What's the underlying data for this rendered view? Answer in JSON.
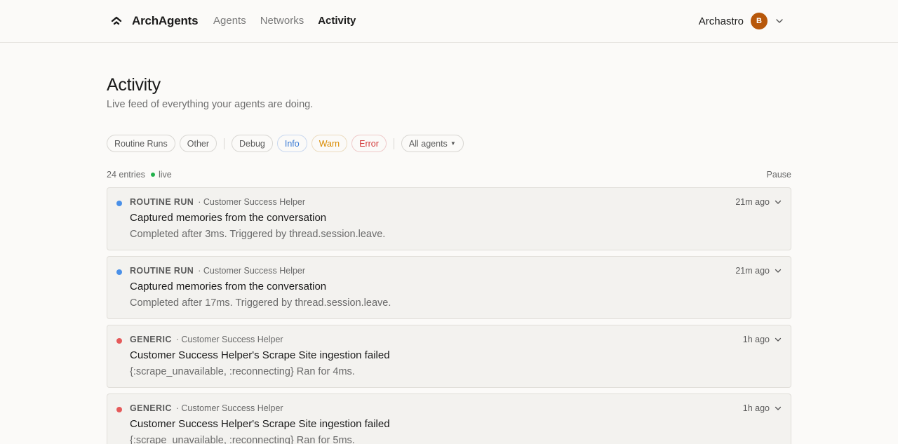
{
  "header": {
    "brand": "ArchAgents",
    "nav": [
      {
        "label": "Agents",
        "active": false
      },
      {
        "label": "Networks",
        "active": false
      },
      {
        "label": "Activity",
        "active": true
      }
    ],
    "user_name": "Archastro",
    "avatar_initial": "B",
    "avatar_color": "#b7570a"
  },
  "page": {
    "title": "Activity",
    "subtitle": "Live feed of everything your agents are doing."
  },
  "filters": {
    "routine_runs": "Routine Runs",
    "other": "Other",
    "debug": "Debug",
    "info": "Info",
    "warn": "Warn",
    "error": "Error",
    "agents_select": "All agents"
  },
  "feed_meta": {
    "entries": "24 entries",
    "live": "live",
    "pause": "Pause"
  },
  "entries": [
    {
      "kind": "ROUTINE RUN",
      "source": "· Customer Success Helper",
      "time": "21m ago",
      "title": "Captured memories from the conversation",
      "detail": "Completed after 3ms. Triggered by thread.session.leave.",
      "dot": "blue"
    },
    {
      "kind": "ROUTINE RUN",
      "source": "· Customer Success Helper",
      "time": "21m ago",
      "title": "Captured memories from the conversation",
      "detail": "Completed after 17ms. Triggered by thread.session.leave.",
      "dot": "blue"
    },
    {
      "kind": "GENERIC",
      "source": "· Customer Success Helper",
      "time": "1h ago",
      "title": "Customer Success Helper's Scrape Site ingestion failed",
      "detail": "{:scrape_unavailable, :reconnecting} Ran for 4ms.",
      "dot": "red"
    },
    {
      "kind": "GENERIC",
      "source": "· Customer Success Helper",
      "time": "1h ago",
      "title": "Customer Success Helper's Scrape Site ingestion failed",
      "detail": "{:scrape_unavailable, :reconnecting} Ran for 5ms.",
      "dot": "red"
    }
  ]
}
